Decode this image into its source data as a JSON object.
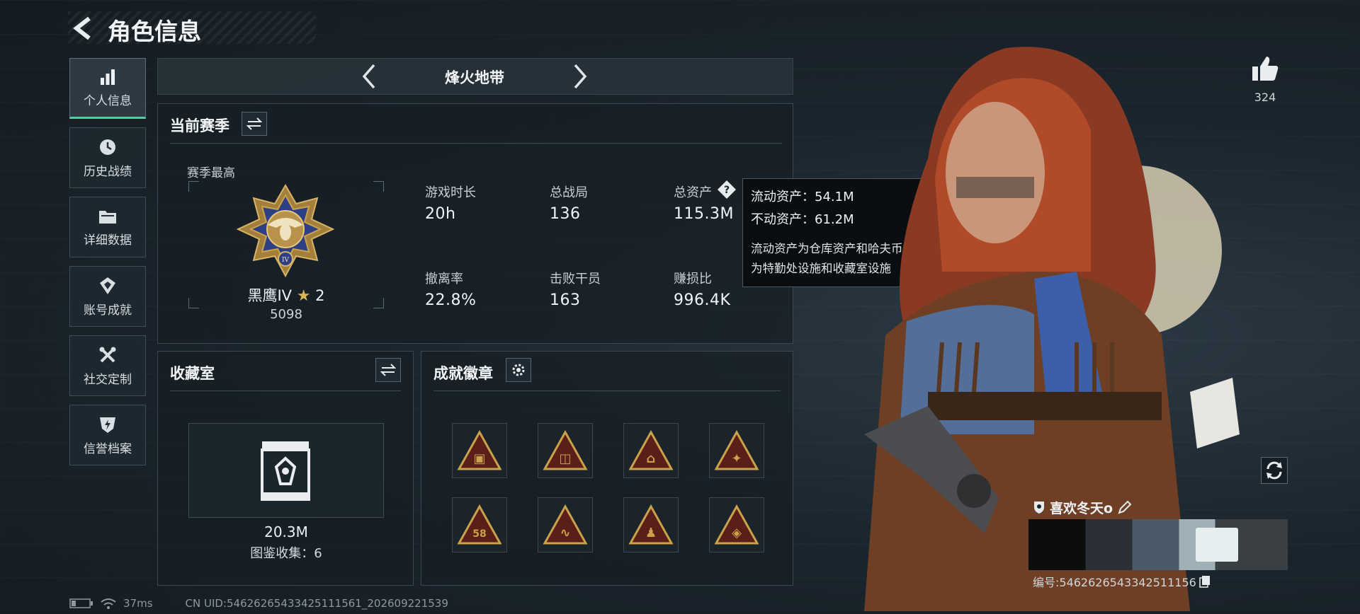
{
  "header": {
    "title": "角色信息"
  },
  "sidebar": {
    "items": [
      {
        "label": "个人信息",
        "icon": "bar-chart-icon",
        "active": true
      },
      {
        "label": "历史战绩",
        "icon": "clock-icon"
      },
      {
        "label": "详细数据",
        "icon": "folder-icon"
      },
      {
        "label": "账号成就",
        "icon": "trophy-icon"
      },
      {
        "label": "社交定制",
        "icon": "wrench-icon"
      },
      {
        "label": "信誉档案",
        "icon": "shield-icon"
      }
    ]
  },
  "mode_selector": {
    "label": "烽火地带"
  },
  "season": {
    "title": "当前赛季",
    "best_label": "赛季最高",
    "rank_name": "黑鹰IV",
    "rank_stars": "2",
    "rank_score": "5098",
    "stats": [
      {
        "label": "游戏时长",
        "value": "20h"
      },
      {
        "label": "总战局",
        "value": "136"
      },
      {
        "label": "总资产",
        "value": "115.3M"
      },
      {
        "label": "撤离率",
        "value": "22.8%"
      },
      {
        "label": "击败干员",
        "value": "163"
      },
      {
        "label": "赚损比",
        "value": "996.4K"
      }
    ]
  },
  "tooltip": {
    "liquid": "流动资产：54.1M",
    "fixed": "不动资产：61.2M",
    "desc_line1": "流动资产为仓库资产和哈夫币，不动资产",
    "desc_line2": "为特勤处设施和收藏室设施"
  },
  "collection": {
    "title": "收藏室",
    "value": "20.3M",
    "count_label": "图鉴收集：6"
  },
  "achievements": {
    "title": "成就徽章",
    "badges": [
      "badge-crate-icon",
      "badge-canister-icon",
      "badge-camp-icon",
      "badge-runner-icon",
      "badge-58-icon",
      "badge-fish-icon",
      "badge-sitting-icon",
      "badge-gem-icon"
    ]
  },
  "profile": {
    "likes": "324",
    "player_name": "喜欢冬天o",
    "player_id": "编号:5462626543342511156"
  },
  "status_bar": {
    "ping": "37ms",
    "uid": "CN UID:546262654334251115​61_202609221539"
  },
  "colors": {
    "accent_green": "#49d39a",
    "gold": "#c9a24a",
    "badge_red": "#5a1f18"
  }
}
